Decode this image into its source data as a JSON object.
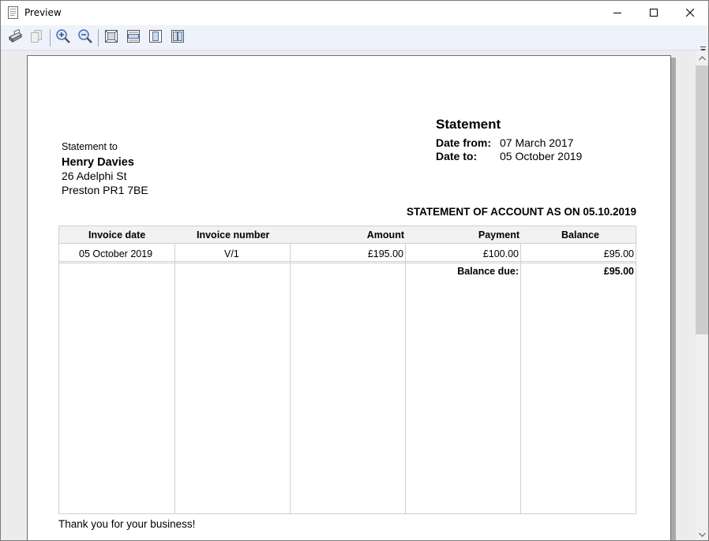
{
  "window": {
    "title": "Preview",
    "icons": {
      "app": "document-preview-icon",
      "minimize": "minimize-icon",
      "maximize": "maximize-icon",
      "close": "close-icon"
    }
  },
  "toolbar": {
    "buttons": [
      {
        "name": "print-button",
        "icon": "printer-icon"
      },
      {
        "name": "copy-button",
        "icon": "copy-icon"
      },
      {
        "name": "zoom-in-button",
        "icon": "zoom-in-icon"
      },
      {
        "name": "zoom-out-button",
        "icon": "zoom-out-icon"
      },
      {
        "name": "fit-whole-page-button",
        "icon": "fit-page-icon"
      },
      {
        "name": "fit-page-width-button",
        "icon": "fit-width-icon"
      },
      {
        "name": "single-page-button",
        "icon": "single-page-icon"
      },
      {
        "name": "two-pages-button",
        "icon": "two-pages-icon"
      }
    ]
  },
  "document": {
    "title": "Statement",
    "date_from_label": "Date from:",
    "date_from": "07 March 2017",
    "date_to_label": "Date to:",
    "date_to": "05 October 2019",
    "statement_to_label": "Statement to",
    "customer": {
      "name": "Henry Davies",
      "address_line1": "26 Adelphi St",
      "address_line2": "Preston PR1 7BE"
    },
    "heading": "STATEMENT OF ACCOUNT AS ON 05.10.2019",
    "table": {
      "headers": [
        "Invoice date",
        "Invoice number",
        "Amount",
        "Payment",
        "Balance"
      ],
      "rows": [
        [
          "05 October 2019",
          "V/1",
          "£195.00",
          "£100.00",
          "£95.00"
        ]
      ],
      "balance_due_label": "Balance due:",
      "balance_due_value": "£95.00"
    },
    "footer": "Thank you for your business!"
  },
  "colors": {
    "toolbar_bg": "#eef2fb",
    "preview_bg": "#ececec",
    "table_header_bg": "#f2f2f2",
    "table_border": "#cfcfcf"
  }
}
